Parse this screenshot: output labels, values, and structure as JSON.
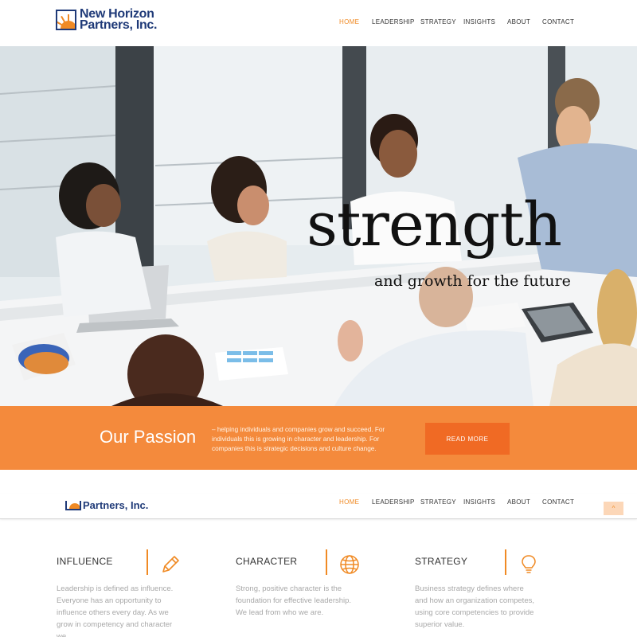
{
  "brand": {
    "name_line1": "New Horizon",
    "name_line2": "Partners, Inc.",
    "sticky_name": "Partners, Inc.",
    "colors": {
      "primary": "#1f3a78",
      "accent": "#f08a24",
      "band": "#f48a3c",
      "button": "#f06a24"
    }
  },
  "nav": {
    "items": [
      {
        "label": "HOME",
        "active": true
      },
      {
        "label": "LEADERSHIP",
        "active": false
      },
      {
        "label": "STRATEGY",
        "active": false
      },
      {
        "label": "INSIGHTS",
        "active": false
      },
      {
        "label": "ABOUT",
        "active": false
      },
      {
        "label": "CONTACT",
        "active": false
      }
    ]
  },
  "hero": {
    "title": "strength",
    "subtitle": "and growth for the future"
  },
  "passion": {
    "title": "Our Passion",
    "text": "– helping individuals and companies grow and succeed. For individuals this is growing in character and leadership. For companies this is strategic decisions and culture change.",
    "button": "READ MORE"
  },
  "scroll_top": {
    "icon": "chevron-up-icon",
    "glyph": "^"
  },
  "features": [
    {
      "title": "INFLUENCE",
      "icon": "pencil-icon",
      "text": "Leadership is defined as influence. Everyone has an opportunity to influence others every day. As we grow in competency and character we"
    },
    {
      "title": "CHARACTER",
      "icon": "globe-icon",
      "text": "Strong, positive character is the foundation for effective leadership. We lead from who we are."
    },
    {
      "title": "STRATEGY",
      "icon": "lightbulb-icon",
      "text": "Business strategy defines where and how an organization competes, using core competencies to provide superior value."
    }
  ]
}
